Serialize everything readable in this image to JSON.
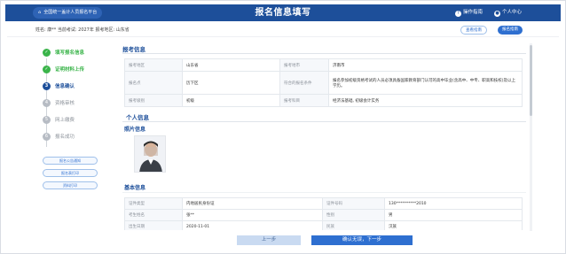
{
  "header": {
    "platform_label": "全国统一盖计人员报名平台",
    "title": "报名信息填写",
    "help_label": "操作指南",
    "user_label": "个人中心"
  },
  "infobar": {
    "text": "姓名: 康**   当前考试: 2027年                           报考地区: 山东省",
    "button_left": "查看指南",
    "button_right": "报名指南"
  },
  "steps": [
    {
      "label": "填写报名信息",
      "state": "done",
      "num": "✓"
    },
    {
      "label": "证明材料上传",
      "state": "done",
      "num": "✓"
    },
    {
      "label": "信息确认",
      "state": "current",
      "num": "3"
    },
    {
      "label": "资格审核",
      "state": "todo",
      "num": "4"
    },
    {
      "label": "网上缴费",
      "state": "todo",
      "num": "5"
    },
    {
      "label": "报名成功",
      "state": "todo",
      "num": "6"
    }
  ],
  "side_buttons": [
    "报名公告通知",
    "报名表打印",
    "资料打印"
  ],
  "exam_section": {
    "title": "报考信息",
    "rows": [
      [
        "报考地区",
        "山东省",
        "报考地市",
        "济南市"
      ],
      [
        "报名点",
        "历下区",
        "符合的报名条件",
        "报名参加初级资格考试的人员必须具备国家教育部门认可的高中毕业(含高中、中专、职高和技校)及以上学历。"
      ],
      [
        "报考级别",
        "初级",
        "报考科目",
        "经济法基础, 初级会计实务"
      ]
    ]
  },
  "personal_section": {
    "title": "个人信息",
    "photo_title": "照片信息",
    "basic_title": "基本信息",
    "rows": [
      [
        "证件类型",
        "内地居民身份证",
        "证件号码",
        "130**********2010"
      ],
      [
        "考生姓名",
        "张**",
        "性别",
        "男"
      ],
      [
        "出生日期",
        "2020-11-01",
        "民族",
        "汉族"
      ]
    ]
  },
  "buttons": {
    "prev": "上一步",
    "next": "确认无误，下一步"
  },
  "colors": {
    "brand": "#1d4f9a",
    "accent": "#2e6fd0",
    "success": "#3ab44a"
  }
}
